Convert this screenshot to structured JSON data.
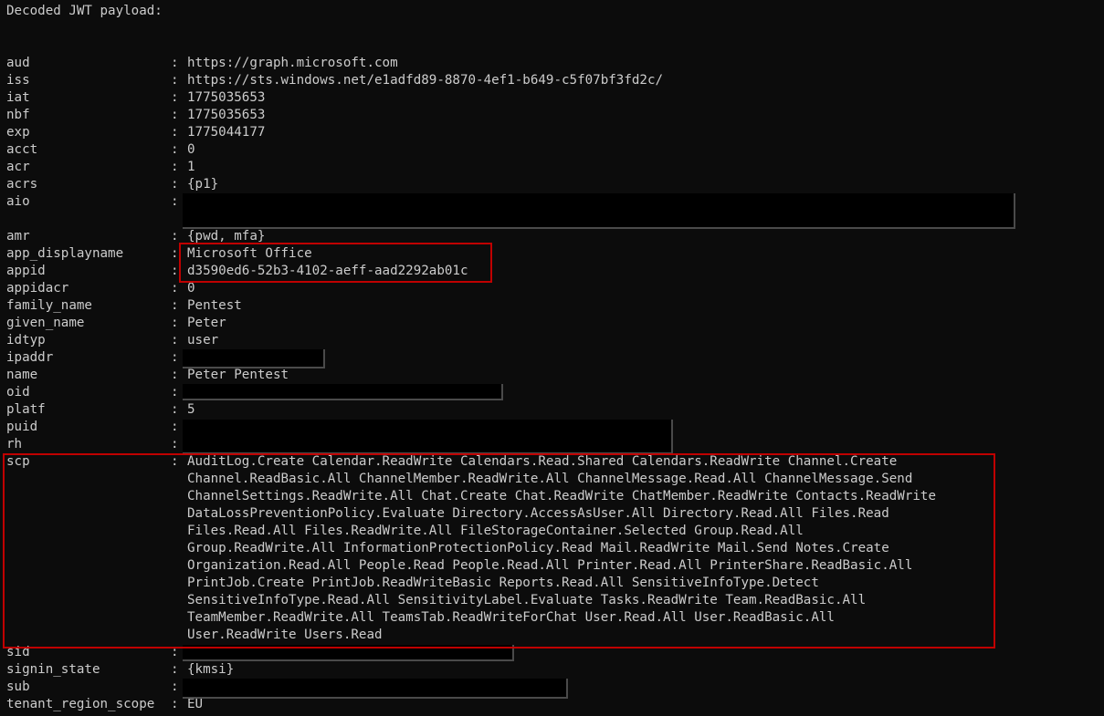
{
  "header": "Decoded JWT payload:",
  "sep": ":",
  "rows": [
    {
      "key": "aud",
      "value": "https://graph.microsoft.com"
    },
    {
      "key": "iss",
      "value": "https://sts.windows.net/e1adfd89-8870-4ef1-b649-c5f07bf3fd2c/"
    },
    {
      "key": "iat",
      "value": "1775035653"
    },
    {
      "key": "nbf",
      "value": "1775035653"
    },
    {
      "key": "exp",
      "value": "1775044177"
    },
    {
      "key": "acct",
      "value": "0"
    },
    {
      "key": "acr",
      "value": "1"
    },
    {
      "key": "acrs",
      "value": "{p1}"
    },
    {
      "key": "aio",
      "value": ""
    },
    {
      "key": "",
      "value": ""
    },
    {
      "key": "amr",
      "value": "{pwd, mfa}"
    },
    {
      "key": "app_displayname",
      "value": "Microsoft Office"
    },
    {
      "key": "appid",
      "value": "d3590ed6-52b3-4102-aeff-aad2292ab01c"
    },
    {
      "key": "appidacr",
      "value": "0"
    },
    {
      "key": "family_name",
      "value": "Pentest"
    },
    {
      "key": "given_name",
      "value": "Peter"
    },
    {
      "key": "idtyp",
      "value": "user"
    },
    {
      "key": "ipaddr",
      "value": ""
    },
    {
      "key": "name",
      "value": "Peter Pentest"
    },
    {
      "key": "oid",
      "value": ""
    },
    {
      "key": "platf",
      "value": "5"
    },
    {
      "key": "puid",
      "value": ""
    },
    {
      "key": "rh",
      "value": ""
    }
  ],
  "scp": {
    "key": "scp",
    "lines": [
      "AuditLog.Create Calendar.ReadWrite Calendars.Read.Shared Calendars.ReadWrite Channel.Create",
      "Channel.ReadBasic.All ChannelMember.ReadWrite.All ChannelMessage.Read.All ChannelMessage.Send",
      "ChannelSettings.ReadWrite.All Chat.Create Chat.ReadWrite ChatMember.ReadWrite Contacts.ReadWrite",
      "DataLossPreventionPolicy.Evaluate Directory.AccessAsUser.All Directory.Read.All Files.Read",
      "Files.Read.All Files.ReadWrite.All FileStorageContainer.Selected Group.Read.All",
      "Group.ReadWrite.All InformationProtectionPolicy.Read Mail.ReadWrite Mail.Send Notes.Create",
      "Organization.Read.All People.Read People.Read.All Printer.Read.All PrinterShare.ReadBasic.All",
      "PrintJob.Create PrintJob.ReadWriteBasic Reports.Read.All SensitiveInfoType.Detect",
      "SensitiveInfoType.Read.All SensitivityLabel.Evaluate Tasks.ReadWrite Team.ReadBasic.All",
      "TeamMember.ReadWrite.All TeamsTab.ReadWriteForChat User.Read.All User.ReadBasic.All",
      "User.ReadWrite Users.Read"
    ]
  },
  "tail_rows": [
    {
      "key": "sid",
      "value": ""
    },
    {
      "key": "signin_state",
      "value": "{kmsi}"
    },
    {
      "key": "sub",
      "value": ""
    },
    {
      "key": "tenant_region_scope",
      "value": "EU"
    }
  ],
  "colors": {
    "background": "#0c0c0c",
    "text": "#cccccc",
    "highlight_box": "#c00000",
    "redaction": "#000000"
  }
}
